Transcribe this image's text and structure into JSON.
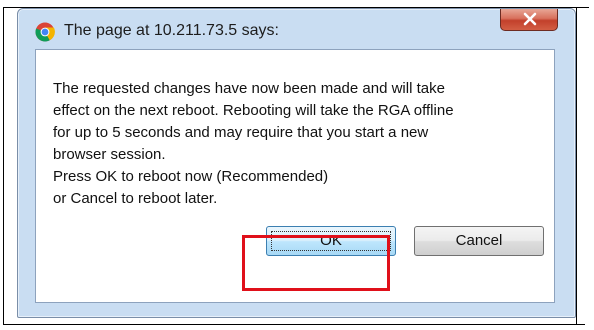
{
  "dialog": {
    "title": "The page at 10.211.73.5 says:",
    "message_lines": [
      "The requested changes have now been made and will take",
      "effect on the next reboot. Rebooting will take the RGA offline",
      "for up to 5 seconds and may require that you start a new",
      "browser session.",
      "Press OK to reboot now (Recommended)",
      "or Cancel to reboot later."
    ],
    "ok_label": "OK",
    "cancel_label": "Cancel",
    "title_icon": "chrome-icon",
    "close_icon": "close-icon"
  },
  "colors": {
    "highlight": "#e0101a",
    "close_button": "#c2402b",
    "frame": "#c9ddf2"
  }
}
